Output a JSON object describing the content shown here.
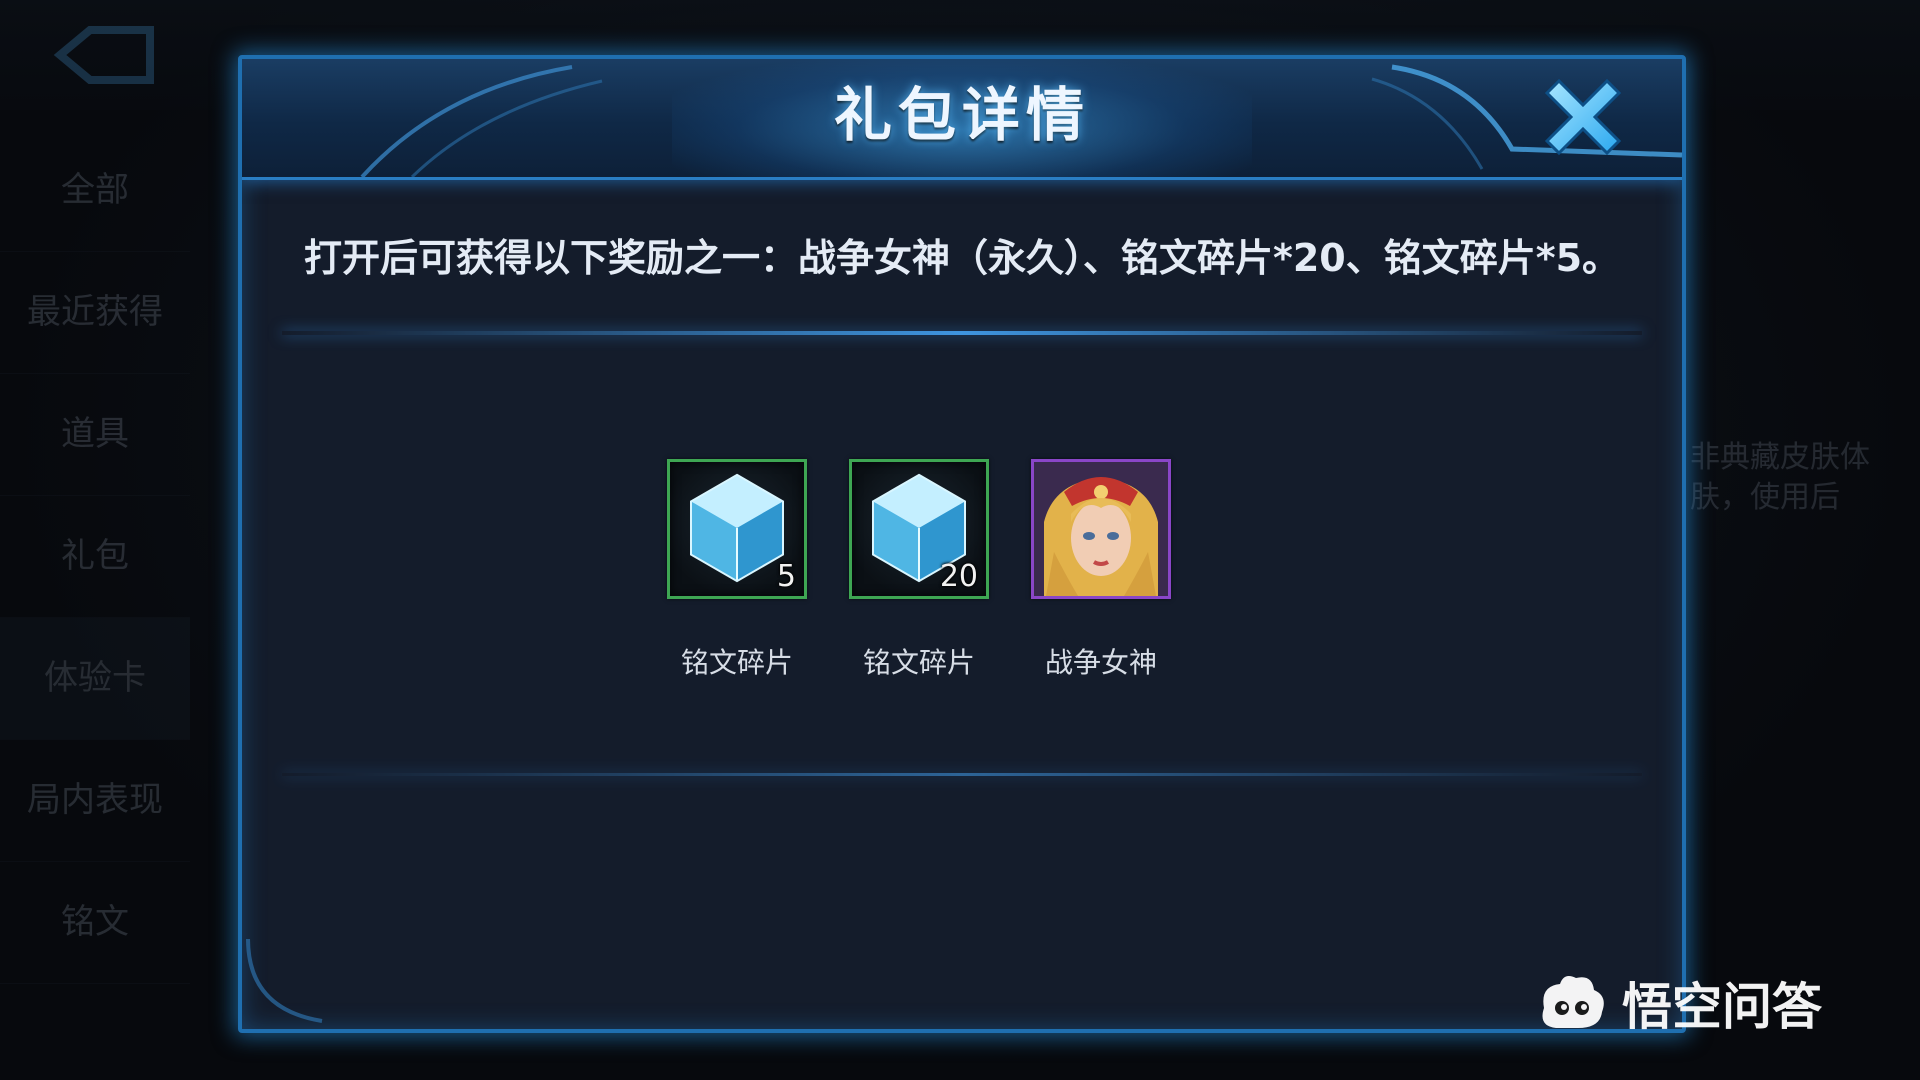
{
  "background": {
    "sidebar_items": [
      "全部",
      "最近获得",
      "道具",
      "礼包",
      "体验卡",
      "局内表现",
      "铭文"
    ],
    "right_hint_lines": [
      "非典藏皮肤体",
      "肤，使用后"
    ]
  },
  "modal": {
    "title": "礼包详情",
    "description": "打开后可获得以下奖励之一：战争女神（永久）、铭文碎片*20、铭文碎片*5。",
    "rewards": [
      {
        "name": "铭文碎片",
        "count": "5",
        "icon": "inscription-crystal-icon",
        "frame_color": "#3ea653"
      },
      {
        "name": "铭文碎片",
        "count": "20",
        "icon": "inscription-crystal-icon",
        "frame_color": "#3ea653"
      },
      {
        "name": "战争女神",
        "count": "",
        "icon": "hero-portrait-war-goddess",
        "frame_color": "#8a46c8"
      }
    ]
  },
  "watermark": {
    "text": "悟空问答",
    "icon": "wukong-logo-icon"
  },
  "colors": {
    "accent_blue": "#1f6fb0",
    "glow_blue": "#46b4ff",
    "close_x": "#3fc0ff",
    "panel_bg": "#141c2b"
  }
}
